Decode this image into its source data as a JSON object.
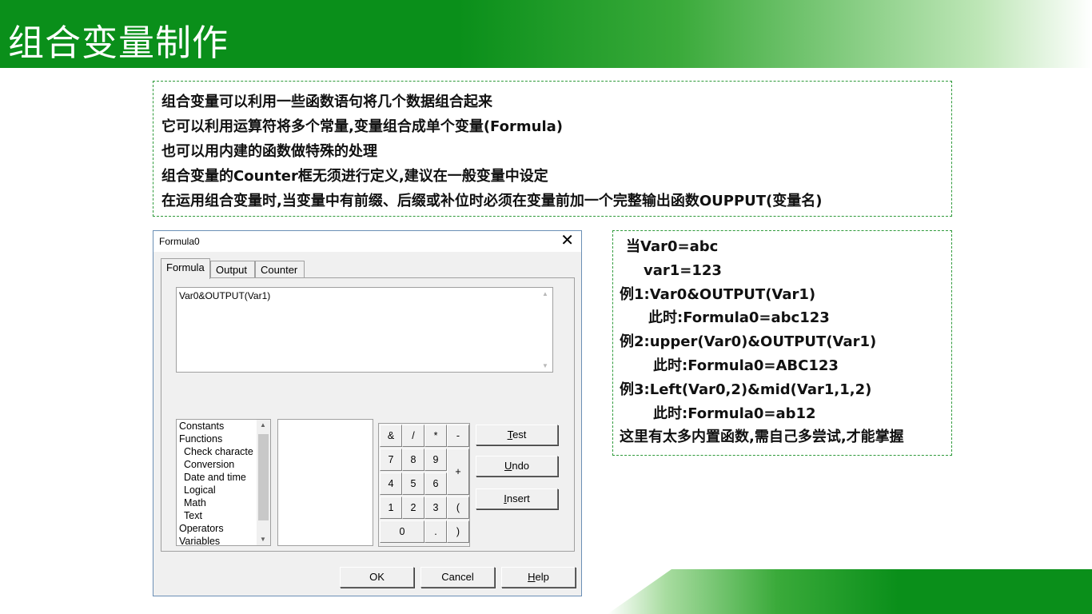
{
  "slide": {
    "title": "组合变量制作",
    "info_lines": [
      "组合变量可以利用一些函数语句将几个数据组合起来",
      "它可以利用运算符将多个常量,变量组合成单个变量(Formula)",
      "也可以用内建的函数做特殊的处理",
      "组合变量的Counter框无须进行定义,建议在一般变量中设定",
      "在运用组合变量时,当变量中有前缀、后缀或补位时必须在变量前加一个完整输出函数OUPPUT(变量名)"
    ],
    "examples": [
      "当Var0=abc",
      "var1=123",
      "例1:Var0&OUTPUT(Var1)",
      "此时:Formula0=abc123",
      "例2:upper(Var0)&OUTPUT(Var1)",
      "此时:Formula0=ABC123",
      "例3:Left(Var0,2)&mid(Var1,1,2)",
      "此时:Formula0=ab12",
      "这里有太多内置函数,需自己多尝试,才能掌握"
    ]
  },
  "dialog": {
    "title": "Formula0",
    "close_glyph": "✕",
    "tabs": [
      "Formula",
      "Output",
      "Counter"
    ],
    "formula_value": "Var0&OUTPUT(Var1)",
    "categories": [
      {
        "label": "Constants",
        "sub": false
      },
      {
        "label": "Functions",
        "sub": false
      },
      {
        "label": "Check characte",
        "sub": true
      },
      {
        "label": "Conversion",
        "sub": true
      },
      {
        "label": "Date and time",
        "sub": true
      },
      {
        "label": "Logical",
        "sub": true
      },
      {
        "label": "Math",
        "sub": true
      },
      {
        "label": "Text",
        "sub": true
      },
      {
        "label": "Operators",
        "sub": false
      },
      {
        "label": "Variables",
        "sub": false
      }
    ],
    "keypad": {
      "k_amp": "&",
      "k_slash": "/",
      "k_star": "*",
      "k_minus": "-",
      "k_7": "7",
      "k_8": "8",
      "k_9": "9",
      "k_plus": "+",
      "k_4": "4",
      "k_5": "5",
      "k_6": "6",
      "k_1": "1",
      "k_2": "2",
      "k_3": "3",
      "k_lparen": "(",
      "k_0": "0",
      "k_dot": ".",
      "k_rparen": ")"
    },
    "buttons": {
      "test_key": "T",
      "test_rest": "est",
      "undo_key": "U",
      "undo_rest": "ndo",
      "insert_key": "I",
      "insert_rest": "nsert",
      "ok": "OK",
      "cancel": "Cancel",
      "help_key": "H",
      "help_rest": "elp"
    },
    "icons": {
      "scroll_up": "▲",
      "scroll_down": "▼"
    }
  }
}
